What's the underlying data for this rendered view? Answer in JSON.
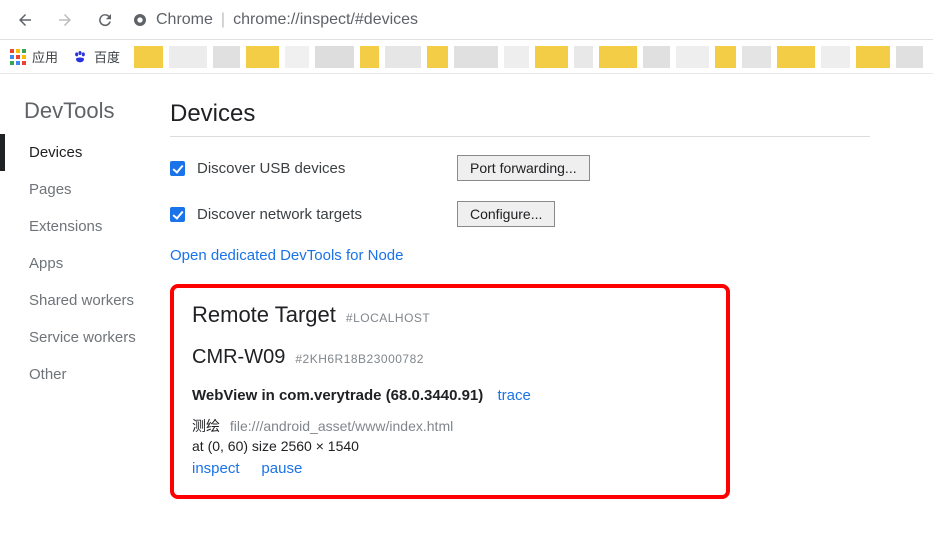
{
  "toolbar": {
    "address_proto": "Chrome",
    "address_path": "chrome://inspect/#devices"
  },
  "bookmarks": {
    "apps_label": "应用",
    "baidu_label": "百度"
  },
  "sidebar": {
    "title": "DevTools",
    "items": [
      {
        "label": "Devices",
        "active": true
      },
      {
        "label": "Pages",
        "active": false
      },
      {
        "label": "Extensions",
        "active": false
      },
      {
        "label": "Apps",
        "active": false
      },
      {
        "label": "Shared workers",
        "active": false
      },
      {
        "label": "Service workers",
        "active": false
      },
      {
        "label": "Other",
        "active": false
      }
    ]
  },
  "content": {
    "heading": "Devices",
    "discover_usb_label": "Discover USB devices",
    "discover_net_label": "Discover network targets",
    "port_forwarding_btn": "Port forwarding...",
    "configure_btn": "Configure...",
    "node_link": "Open dedicated DevTools for Node"
  },
  "remote": {
    "title": "Remote Target",
    "title_tag": "#LOCALHOST",
    "device_name": "CMR-W09",
    "device_id": "#2KH6R18B23000782",
    "webview_label": "WebView in com.verytrade (68.0.3440.91)",
    "trace_label": "trace",
    "page_title": "测绘",
    "page_url": "file:///android_asset/www/index.html",
    "position_size": "at (0, 60)  size 2560 × 1540",
    "inspect_label": "inspect",
    "pause_label": "pause"
  }
}
